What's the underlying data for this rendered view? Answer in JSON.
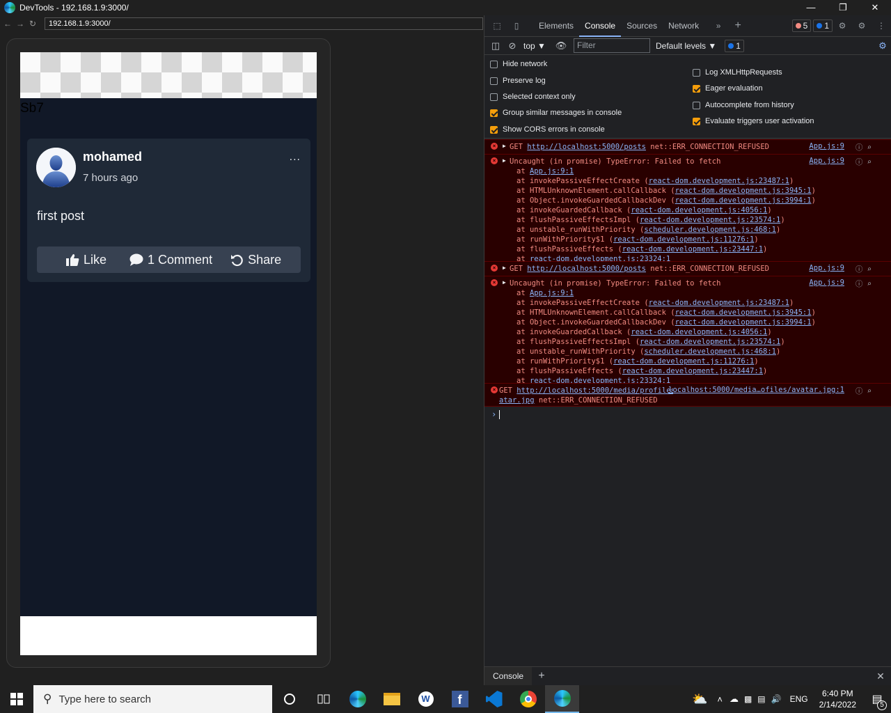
{
  "window": {
    "title": "DevTools - 192.168.1.9:3000/"
  },
  "browser": {
    "url": "192.168.1.9:3000/"
  },
  "app": {
    "header_text": "Sb7",
    "post": {
      "username": "mohamed",
      "time": "7 hours ago",
      "more": "...",
      "content": "first post",
      "actions": {
        "like": "Like",
        "comment": "1 Comment",
        "share": "Share"
      }
    }
  },
  "devtools": {
    "tabs": [
      "Elements",
      "Console",
      "Sources",
      "Network"
    ],
    "active_tab": "Console",
    "error_count": "5",
    "info_count": "1",
    "toolbar": {
      "context": "top",
      "filter_placeholder": "Filter",
      "levels": "Default levels",
      "issues": "1"
    },
    "settings": {
      "hide_network": "Hide network",
      "preserve_log": "Preserve log",
      "selected_context": "Selected context only",
      "group_similar": "Group similar messages in console",
      "show_cors": "Show CORS errors in console",
      "log_xhr": "Log XMLHttpRequests",
      "eager_eval": "Eager evaluation",
      "autocomplete": "Autocomplete from history",
      "evaluate_triggers": "Evaluate triggers user activation"
    },
    "messages": {
      "get1": {
        "prefix": "GET ",
        "url": "http://localhost:5000/posts",
        "error": " net::ERR_CONNECTION_REFUSED",
        "source": "App.js:9"
      },
      "err1": {
        "text": "Uncaught (in promise) TypeError: Failed to fetch",
        "source": "App.js:9"
      },
      "get2": {
        "prefix": "GET ",
        "url": "http://localhost:5000/posts",
        "error": " net::ERR_CONNECTION_REFUSED",
        "source": "App.js:9"
      },
      "err2": {
        "text": "Uncaught (in promise) TypeError: Failed to fetch",
        "source": "App.js:9"
      },
      "get3": {
        "prefix": "GET ",
        "url1": "http://localhost:5000/media/profiles/av",
        "url2": "atar.jpg",
        "error": " net::ERR_CONNECTION_REFUSED",
        "source": "localhost:5000/media…ofiles/avatar.jpg:1"
      }
    },
    "stack": [
      {
        "fn": "",
        "loc": "App.js:9:1"
      },
      {
        "fn": "invokePassiveEffectCreate ",
        "loc": "react-dom.development.js:23487:1"
      },
      {
        "fn": "HTMLUnknownElement.callCallback ",
        "loc": "react-dom.development.js:3945:1"
      },
      {
        "fn": "Object.invokeGuardedCallbackDev ",
        "loc": "react-dom.development.js:3994:1"
      },
      {
        "fn": "invokeGuardedCallback ",
        "loc": "react-dom.development.js:4056:1"
      },
      {
        "fn": "flushPassiveEffectsImpl ",
        "loc": "react-dom.development.js:23574:1"
      },
      {
        "fn": "unstable_runWithPriority ",
        "loc": "scheduler.development.js:468:1"
      },
      {
        "fn": "runWithPriority$1 ",
        "loc": "react-dom.development.js:11276:1"
      },
      {
        "fn": "flushPassiveEffects ",
        "loc": "react-dom.development.js:23447:1"
      },
      {
        "fn": "",
        "loc": "react-dom.development.js:23324:1"
      }
    ],
    "drawer_tab": "Console"
  },
  "taskbar": {
    "search_placeholder": "Type here to search",
    "lang": "ENG",
    "time": "6:40 PM",
    "date": "2/14/2022",
    "notifications": "5"
  },
  "colors": {
    "accent": "#8ab4f8",
    "error": "#f28b82",
    "checkbox_on": "#f59e0b",
    "app_bg": "#111827",
    "card_bg": "#1f2937"
  }
}
